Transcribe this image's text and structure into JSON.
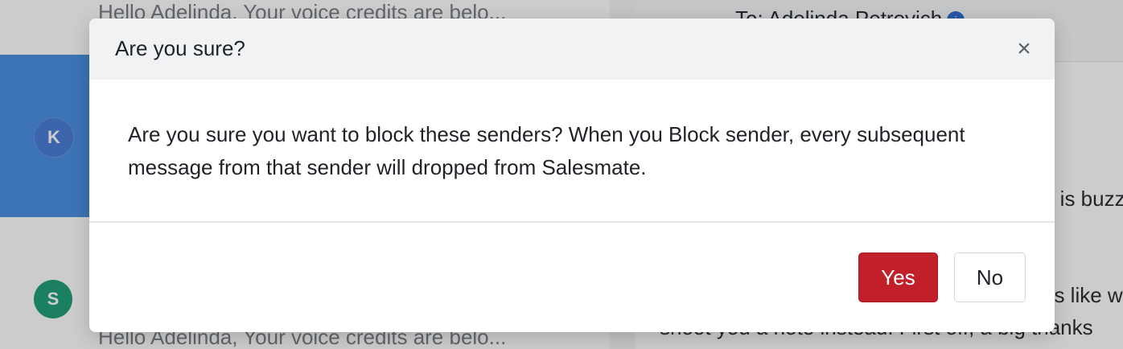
{
  "background": {
    "list": {
      "preview_top": "Hello Adelinda, Your voice credits are belo...",
      "preview_bottom": "Hello Adelinda, Your voice credits are belo...",
      "avatar_selected_initial": "K",
      "avatar_second_initial": "S"
    },
    "conversation": {
      "to_line": "To: Adelinda Petrovich",
      "snippet_1": "e is buzz",
      "snippet_2": "ns like w",
      "snippet_3": "shoot you a note instead. First off, a big thanks"
    }
  },
  "modal": {
    "title": "Are you sure?",
    "close_label": "×",
    "message": "Are you sure you want to block these senders? When you Block sender, every subsequent message from that sender will dropped from Salesmate.",
    "yes_label": "Yes",
    "no_label": "No"
  },
  "colors": {
    "selected_row": "#4a90e2",
    "yes_button": "#c1202b",
    "avatar_k": "#4d7fd8",
    "avatar_s": "#21a07a"
  }
}
